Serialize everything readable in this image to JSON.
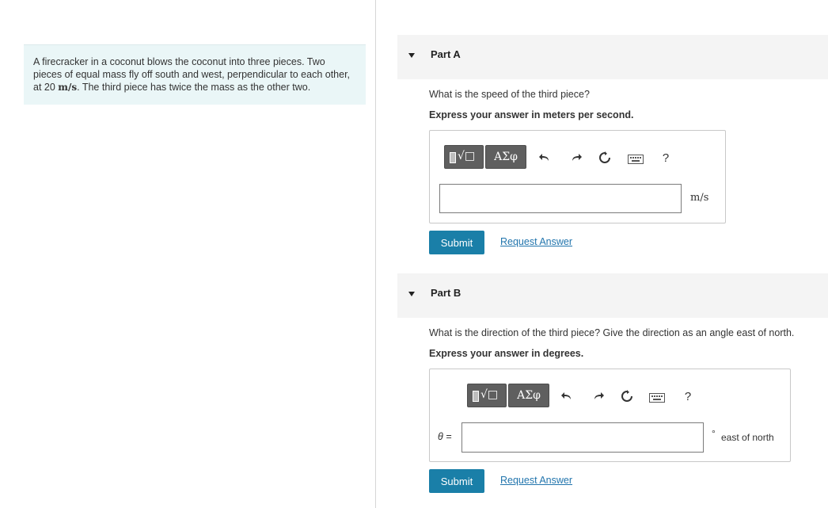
{
  "problem": {
    "text_a": "A firecracker in a coconut blows the coconut into three pieces. Two pieces of equal mass fly off south and west, perpendicular to each other, at 20 ",
    "math": "m/s",
    "text_b": ". The third piece has twice the mass as the other two."
  },
  "part_a": {
    "title": "Part A",
    "question": "What is the speed of the third piece?",
    "instruction": "Express your answer in meters per second.",
    "toolbar": {
      "math_btn": "√□",
      "greek_btn": "ΑΣφ",
      "help": "?"
    },
    "answer_value": "",
    "unit": "m/s",
    "submit": "Submit",
    "request": "Request Answer"
  },
  "part_b": {
    "title": "Part B",
    "question": "What is the direction of the third piece? Give the direction as an angle east of north.",
    "instruction": "Express your answer in degrees.",
    "toolbar": {
      "math_btn": "√□",
      "greek_btn": "ΑΣφ",
      "help": "?"
    },
    "var_label": "θ =",
    "answer_value": "",
    "unit_symbol": "°",
    "unit_text": "east of north",
    "submit": "Submit",
    "request": "Request Answer"
  }
}
